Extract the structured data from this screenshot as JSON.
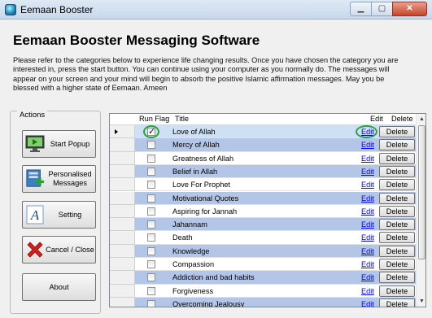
{
  "window": {
    "title": "Eemaan Booster",
    "min_glyph": "▁",
    "max_glyph": "▢",
    "close_glyph": "✕"
  },
  "heading": "Eemaan Booster Messaging Software",
  "intro_lines": [
    "Please refer to the categories below to experience life changing results. Once you  have chosen the category you are",
    "interested in, press the start button. You can continue using your computer as you normally do. The messages will",
    "appear on your screen and your mind will begin to absorb the positive Islamic affirmation messages. May you be",
    "blessed with a higher state of Eemaan. Ameen"
  ],
  "actions": {
    "label": "Actions",
    "buttons": [
      {
        "label": "Start Popup",
        "icon": "monitor-play-icon"
      },
      {
        "label": "Personalised Messages",
        "icon": "add-message-icon"
      },
      {
        "label": "Setting",
        "icon": "font-a-icon"
      },
      {
        "label": "Cancel / Close",
        "icon": "red-x-icon"
      },
      {
        "label": "About",
        "icon": ""
      }
    ]
  },
  "grid": {
    "columns": {
      "run_flag": "Run Flag",
      "title": "Title",
      "edit": "Edit",
      "delete": "Delete"
    },
    "edit_label": "Edit",
    "delete_label": "Delete",
    "rows": [
      {
        "title": "Love of Allah",
        "checked": true
      },
      {
        "title": "Mercy of Allah",
        "checked": false
      },
      {
        "title": "Greatness of Allah",
        "checked": false
      },
      {
        "title": "Belief in Allah",
        "checked": false
      },
      {
        "title": "Love For Prophet",
        "checked": false
      },
      {
        "title": "Motivational Quotes",
        "checked": false
      },
      {
        "title": "Aspiring for Jannah",
        "checked": false
      },
      {
        "title": "Jahannam",
        "checked": false
      },
      {
        "title": "Death",
        "checked": false
      },
      {
        "title": "Knowledge",
        "checked": false
      },
      {
        "title": "Compassion",
        "checked": false
      },
      {
        "title": "Addiction and bad habits",
        "checked": false
      },
      {
        "title": "Forgiveness",
        "checked": false
      },
      {
        "title": "Overcoming Jealousy",
        "checked": false
      }
    ]
  },
  "colors": {
    "highlight_circle": "#2aa33b",
    "alt_row": "#b4c6e7"
  }
}
